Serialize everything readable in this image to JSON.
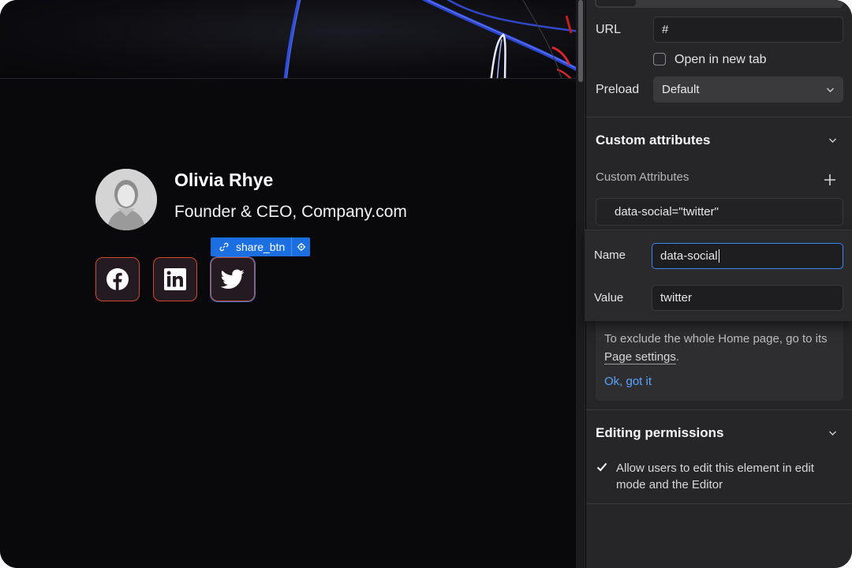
{
  "canvas": {
    "profile": {
      "name": "Olivia Rhye",
      "role": "Founder & CEO, Company.com"
    },
    "social_buttons": [
      {
        "icon": "facebook-icon"
      },
      {
        "icon": "linkedin-icon"
      },
      {
        "icon": "twitter-icon"
      }
    ],
    "selection_label": "share_btn",
    "colors": {
      "button_border": "#d1492c",
      "selection_blue": "#1b6fe0"
    }
  },
  "panel": {
    "url_label": "URL",
    "url_value": "#",
    "open_new_tab_label": "Open in new tab",
    "preload_label": "Preload",
    "preload_value": "Default",
    "custom_attributes": {
      "section_title": "Custom attributes",
      "list_label": "Custom Attributes",
      "existing_attribute": "data-social=\"twitter\"",
      "name_label": "Name",
      "name_value": "data-social",
      "value_label": "Value",
      "value_value": "twitter"
    },
    "info": {
      "text_before": "To exclude the whole Home page, go to its ",
      "link": "Page settings",
      "text_after": ".",
      "ok": "Ok, got it"
    },
    "editing_permissions": {
      "section_title": "Editing permissions",
      "checkbox_label": "Allow users to edit this element in edit mode and the Editor",
      "checked": true
    }
  }
}
